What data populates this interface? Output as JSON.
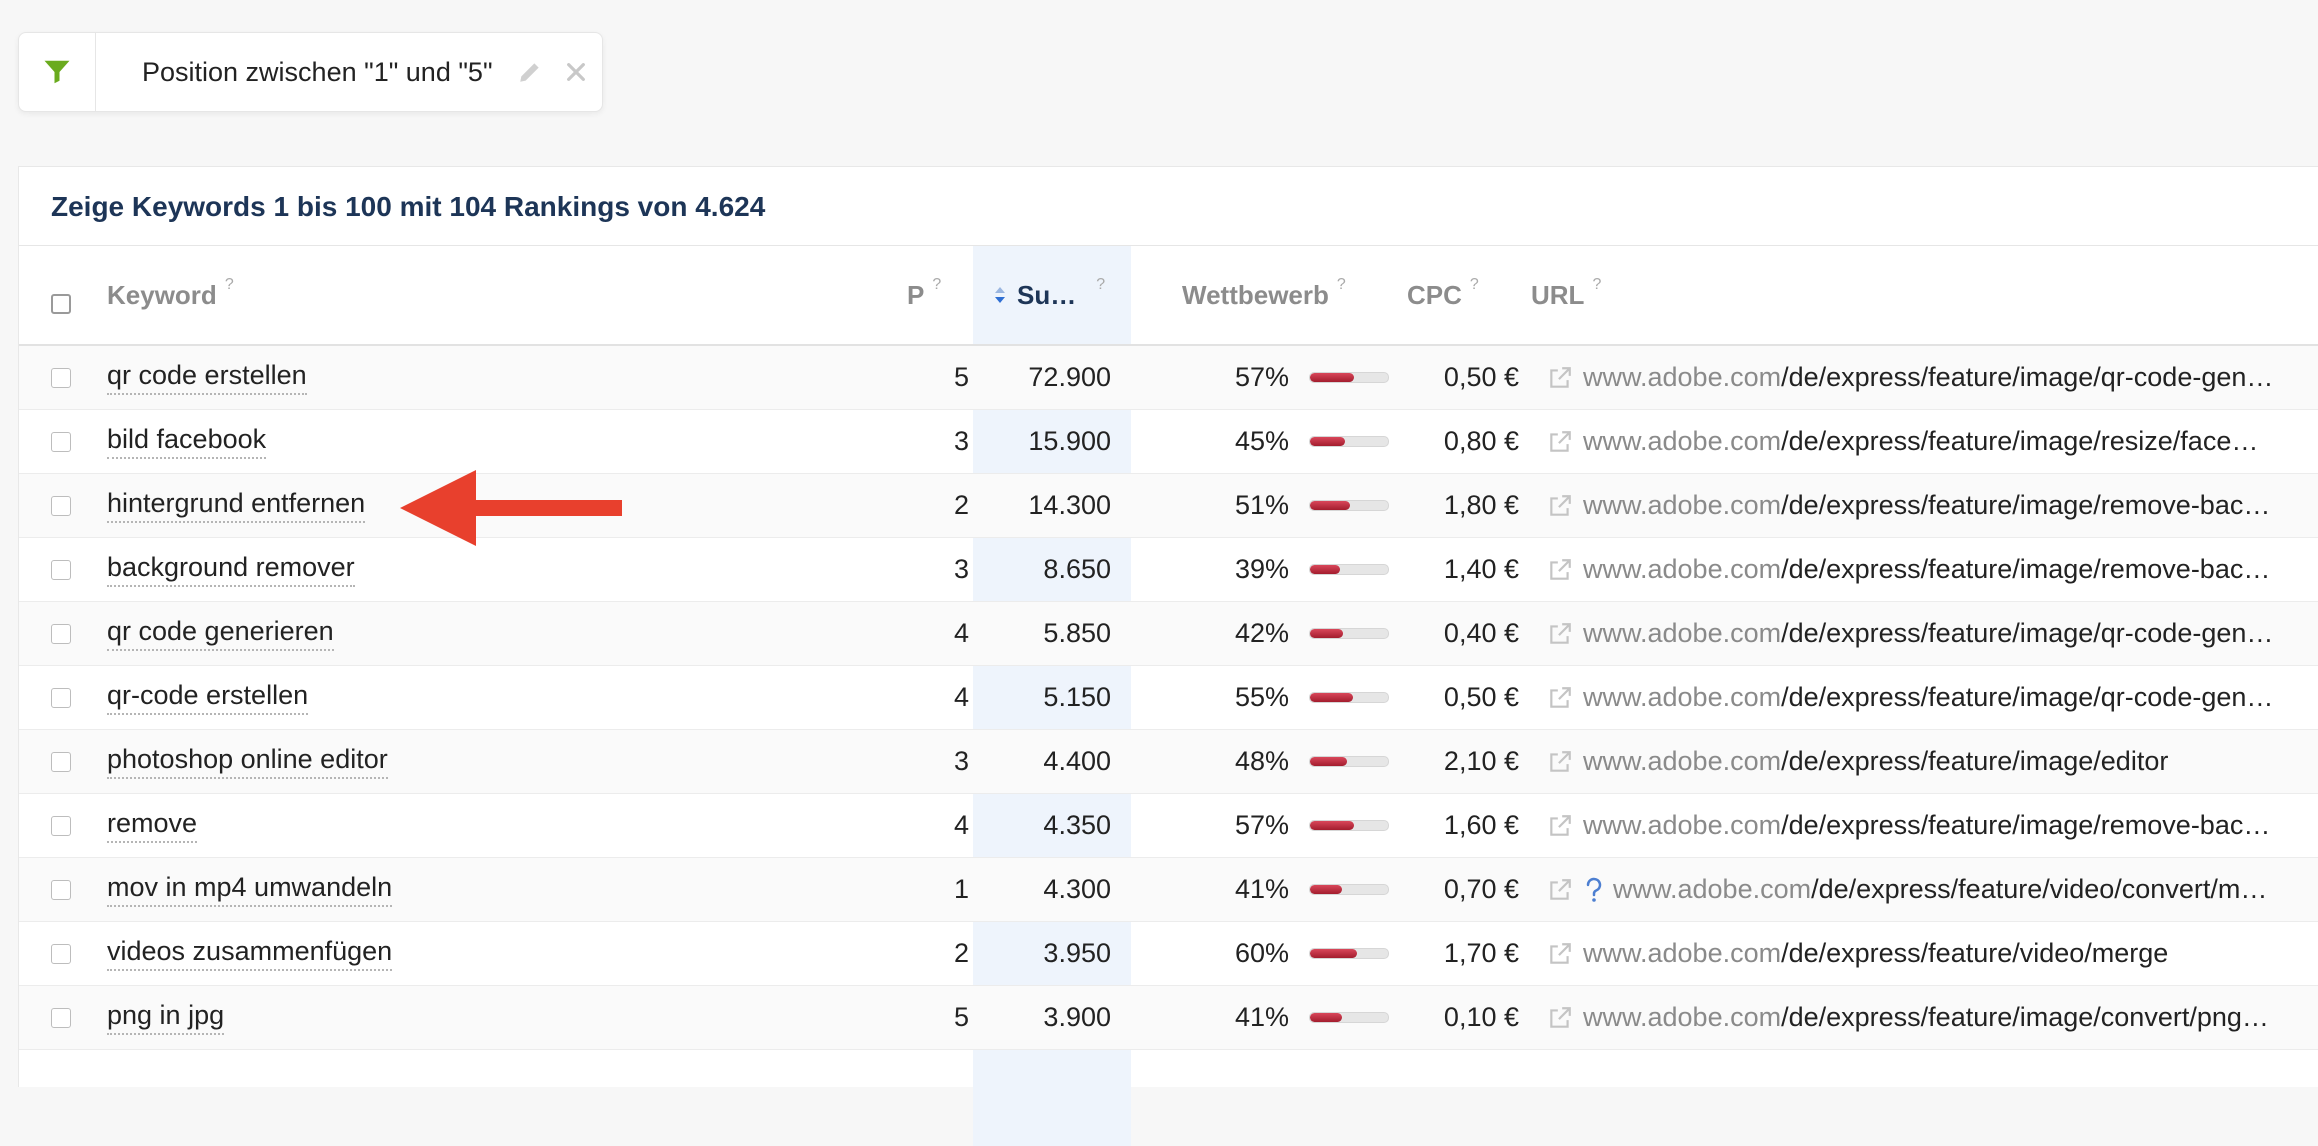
{
  "filter": {
    "text": "Position zwischen \"1\" und \"5\""
  },
  "panel": {
    "title": "Zeige Keywords 1 bis 100 mit 104 Rankings von 4.624"
  },
  "columns": {
    "keyword": "Keyword",
    "position": "P",
    "search_volume": "Su…",
    "competition": "Wettbewerb",
    "cpc": "CPC",
    "url": "URL",
    "help": "?"
  },
  "colors": {
    "accent": "#1d3557",
    "filter_green": "#6aab1e",
    "bar_red": "#c0283a",
    "arrow_red": "#e8402d"
  },
  "rows": [
    {
      "keyword": "qr code erstellen",
      "position": "5",
      "search_volume": "72.900",
      "competition": "57%",
      "competition_value": 0.57,
      "cpc": "0,50 €",
      "url_domain": "www.adobe.com",
      "url_path": "/de/express/feature/image/qr-code-gen…",
      "has_question_icon": false
    },
    {
      "keyword": "bild facebook",
      "position": "3",
      "search_volume": "15.900",
      "competition": "45%",
      "competition_value": 0.45,
      "cpc": "0,80 €",
      "url_domain": "www.adobe.com",
      "url_path": "/de/express/feature/image/resize/face…",
      "has_question_icon": false
    },
    {
      "keyword": "hintergrund entfernen",
      "position": "2",
      "search_volume": "14.300",
      "competition": "51%",
      "competition_value": 0.51,
      "cpc": "1,80 €",
      "url_domain": "www.adobe.com",
      "url_path": "/de/express/feature/image/remove-bac…",
      "has_question_icon": false
    },
    {
      "keyword": "background remover",
      "position": "3",
      "search_volume": "8.650",
      "competition": "39%",
      "competition_value": 0.39,
      "cpc": "1,40 €",
      "url_domain": "www.adobe.com",
      "url_path": "/de/express/feature/image/remove-bac…",
      "has_question_icon": false
    },
    {
      "keyword": "qr code generieren",
      "position": "4",
      "search_volume": "5.850",
      "competition": "42%",
      "competition_value": 0.42,
      "cpc": "0,40 €",
      "url_domain": "www.adobe.com",
      "url_path": "/de/express/feature/image/qr-code-gen…",
      "has_question_icon": false
    },
    {
      "keyword": "qr-code erstellen",
      "position": "4",
      "search_volume": "5.150",
      "competition": "55%",
      "competition_value": 0.55,
      "cpc": "0,50 €",
      "url_domain": "www.adobe.com",
      "url_path": "/de/express/feature/image/qr-code-gen…",
      "has_question_icon": false
    },
    {
      "keyword": "photoshop online editor",
      "position": "3",
      "search_volume": "4.400",
      "competition": "48%",
      "competition_value": 0.48,
      "cpc": "2,10 €",
      "url_domain": "www.adobe.com",
      "url_path": "/de/express/feature/image/editor",
      "has_question_icon": false
    },
    {
      "keyword": "remove",
      "position": "4",
      "search_volume": "4.350",
      "competition": "57%",
      "competition_value": 0.57,
      "cpc": "1,60 €",
      "url_domain": "www.adobe.com",
      "url_path": "/de/express/feature/image/remove-bac…",
      "has_question_icon": false
    },
    {
      "keyword": "mov in mp4 umwandeln",
      "position": "1",
      "search_volume": "4.300",
      "competition": "41%",
      "competition_value": 0.41,
      "cpc": "0,70 €",
      "url_domain": "www.adobe.com",
      "url_path": "/de/express/feature/video/convert/m…",
      "has_question_icon": true
    },
    {
      "keyword": "videos zusammenfügen",
      "position": "2",
      "search_volume": "3.950",
      "competition": "60%",
      "competition_value": 0.6,
      "cpc": "1,70 €",
      "url_domain": "www.adobe.com",
      "url_path": "/de/express/feature/video/merge",
      "has_question_icon": false
    },
    {
      "keyword": "png in jpg",
      "position": "5",
      "search_volume": "3.900",
      "competition": "41%",
      "competition_value": 0.41,
      "cpc": "0,10 €",
      "url_domain": "www.adobe.com",
      "url_path": "/de/express/feature/image/convert/png…",
      "has_question_icon": false
    }
  ]
}
